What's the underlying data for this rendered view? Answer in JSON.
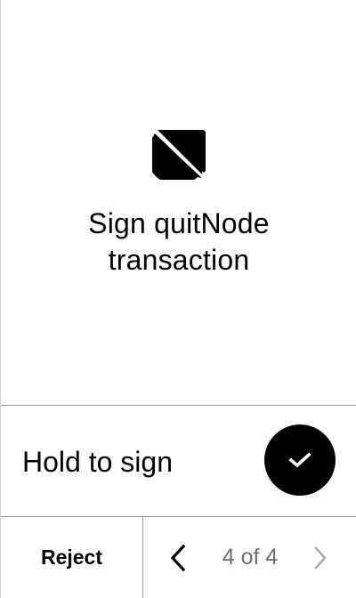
{
  "main": {
    "logo_icon": "ontology-logo-icon",
    "title_line1": "Sign quitNode",
    "title_line2": "transaction"
  },
  "hold": {
    "label": "Hold to sign",
    "button_icon": "check-icon"
  },
  "footer": {
    "reject_label": "Reject",
    "prev_icon": "chevron-left-icon",
    "next_icon": "chevron-right-icon",
    "page_indicator": "4 of 4"
  },
  "colors": {
    "background": "#ffffff",
    "text": "#000000",
    "muted_text": "#6e6e6e",
    "divider": "#9a9a9a",
    "disabled_icon": "#a8a8a8"
  }
}
